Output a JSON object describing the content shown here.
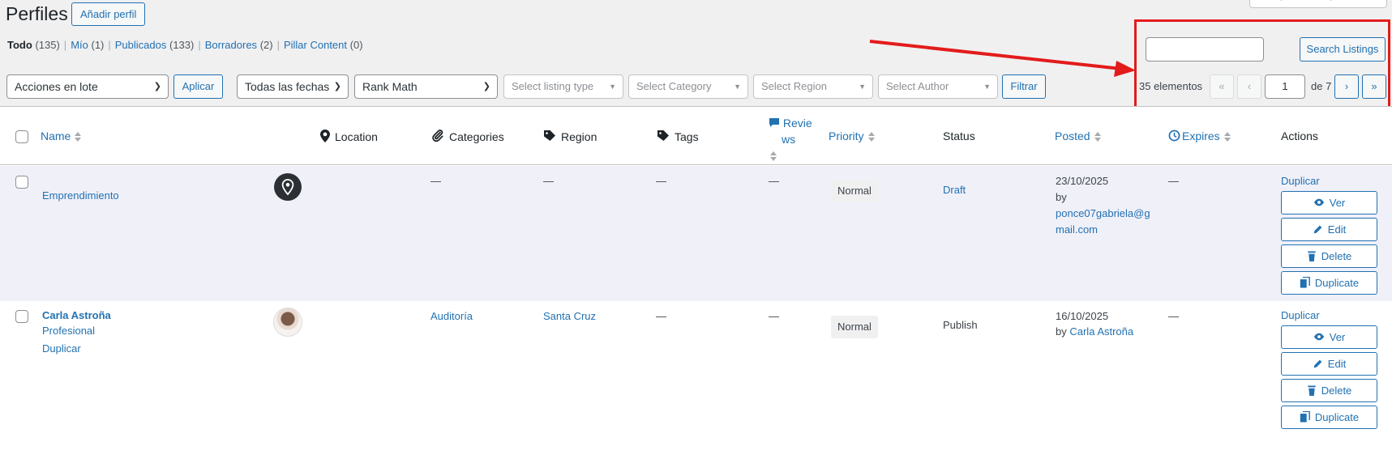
{
  "header": {
    "title": "Perfiles",
    "add_label": "Añadir perfil",
    "screen_options": "Opciones de pantalla"
  },
  "views": [
    {
      "label": "Todo",
      "count": "(135)"
    },
    {
      "label": "Mío",
      "count": "(1)"
    },
    {
      "label": "Publicados",
      "count": "(133)"
    },
    {
      "label": "Borradores",
      "count": "(2)"
    },
    {
      "label": "Pillar Content",
      "count": "(0)"
    }
  ],
  "search": {
    "value": "",
    "button": "Search Listings"
  },
  "filters": {
    "bulk_action": "Acciones en lote",
    "apply": "Aplicar",
    "dates": "Todas las fechas",
    "seo": "Rank Math",
    "listing_type": "Select listing type",
    "category": "Select Category",
    "region": "Select Region",
    "author": "Select Author",
    "filter": "Filtrar"
  },
  "pagination": {
    "items": "35 elementos",
    "first": "«",
    "prev": "‹",
    "current": "1",
    "of": "de 7",
    "next": "›",
    "last": "»"
  },
  "columns": {
    "name": "Name",
    "location": "Location",
    "categories": "Categories",
    "region": "Region",
    "tags": "Tags",
    "reviews_1": "Revie",
    "reviews_2": "ws",
    "priority": "Priority",
    "status": "Status",
    "posted": "Posted",
    "expires": "Expires",
    "actions": "Actions"
  },
  "rows": [
    {
      "name": "Emprendimiento",
      "categories": "—",
      "region": "—",
      "tags": "—",
      "reviews": "—",
      "priority": "Normal",
      "status": "Draft",
      "posted_date": "23/10/2025",
      "posted_by": "by",
      "posted_author_1": "ponce07gabriela@g",
      "posted_author_2": "mail.com",
      "expires": "—",
      "duplicar": "Duplicar",
      "ver": "Ver",
      "edit": "Edit",
      "delete": "Delete",
      "duplicate": "Duplicate"
    },
    {
      "name": "Carla Astroña",
      "type": "Profesional",
      "row_duplicar": "Duplicar",
      "categories": "Auditoría",
      "region": "Santa Cruz",
      "tags": "—",
      "reviews": "—",
      "priority": "Normal",
      "status": "Publish",
      "posted_date": "16/10/2025",
      "posted_by": "by",
      "posted_author": "Carla Astroña",
      "expires": "—",
      "duplicar": "Duplicar",
      "ver": "Ver",
      "edit": "Edit",
      "delete": "Delete",
      "duplicate": "Duplicate"
    }
  ],
  "colors": {
    "link": "#2271b1",
    "highlight": "#e31b1b",
    "row_alt": "#f0f0f9"
  }
}
